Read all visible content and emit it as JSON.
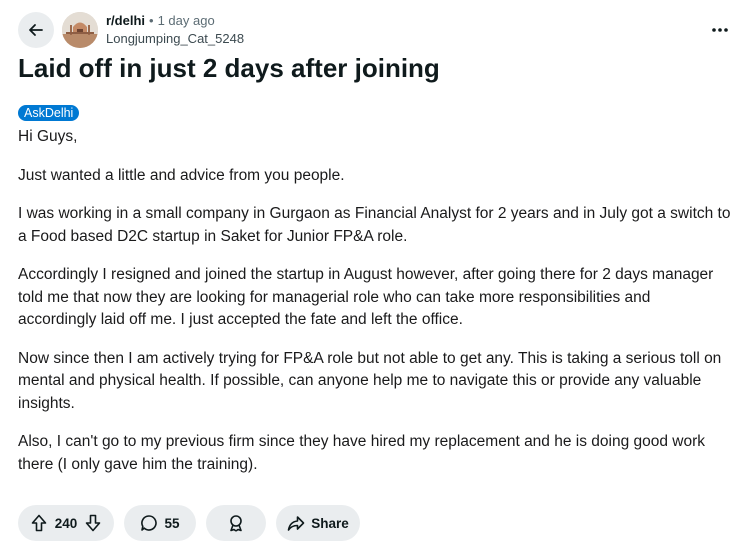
{
  "header": {
    "subreddit": "r/delhi",
    "separator": "•",
    "time": "1 day ago",
    "username": "Longjumping_Cat_5248"
  },
  "post": {
    "title": "Laid off in just 2 days after joining",
    "flair": "AskDelhi",
    "paragraphs": [
      "Hi Guys,",
      "Just wanted a little and advice from you people.",
      "I was working in a small company in Gurgaon as Financial Analyst for 2 years and in July got a switch to a Food based D2C startup in Saket for Junior FP&A role.",
      "Accordingly I resigned and joined the startup in August however, after going there for 2 days manager told me that now they are looking for managerial role who can take more responsibilities and accordingly laid off me. I just accepted the fate and left the office.",
      "Now since then I am actively trying for FP&A role but not able to get any. This is taking a serious toll on mental and physical health. If possible, can anyone help me to navigate this or provide any valuable insights.",
      "Also, I can't go to my previous firm since they have hired my replacement and he is doing good work there (I only gave him the training)."
    ]
  },
  "actions": {
    "votes": "240",
    "comments": "55",
    "share_label": "Share"
  },
  "icons": {
    "back": "arrow-left-icon",
    "more": "more-horizontal-icon",
    "upvote": "upvote-arrow-icon",
    "downvote": "downvote-arrow-icon",
    "comment": "comment-bubble-icon",
    "award": "award-icon",
    "share": "share-arrow-icon"
  },
  "colors": {
    "flair_bg": "#0079d3",
    "pill_bg": "#eaedef",
    "text": "#0f1a1c",
    "meta": "#5c6c74"
  }
}
